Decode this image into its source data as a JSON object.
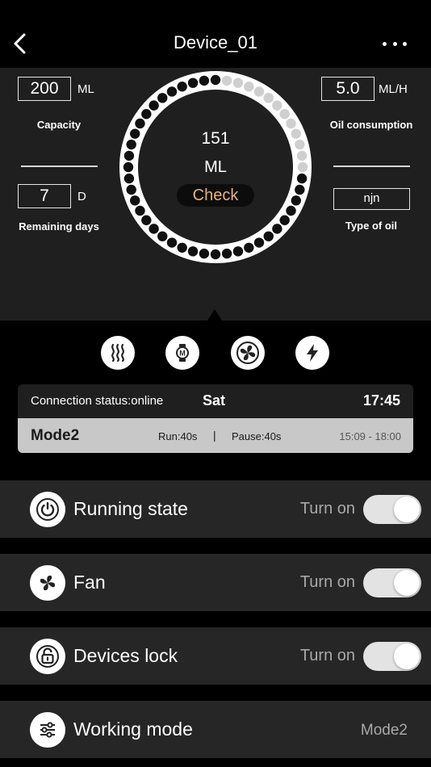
{
  "header": {
    "title": "Device_01"
  },
  "left": {
    "capacity_value": "200",
    "capacity_unit": "ML",
    "capacity_label": "Capacity",
    "days_value": "7",
    "days_unit": "D",
    "days_label": "Remaining days"
  },
  "right": {
    "consumption_value": "5.0",
    "consumption_unit": "ML/H",
    "consumption_label": "Oil consumption",
    "oil_type_value": "njn",
    "oil_type_label": "Type of oil"
  },
  "dial": {
    "reading": "151",
    "unit": "ML",
    "check_label": "Check",
    "level_fraction": 0.75,
    "filled_color": "#111111",
    "empty_color": "#cfcfcf",
    "ring_color": "#ffffff"
  },
  "icons": [
    "heat-icon",
    "device-mode-icon",
    "fan-icon",
    "power-bolt-icon"
  ],
  "status": {
    "connection": "Connection status:online",
    "day": "Sat",
    "time": "17:45",
    "mode": "Mode2",
    "run": "Run:40s",
    "separator": "|",
    "pause": "Pause:40s",
    "range": "15:09 - 18:00"
  },
  "rows": {
    "running": {
      "label": "Running state",
      "state": "Turn on",
      "toggle_on": true
    },
    "fan": {
      "label": "Fan",
      "state": "Turn on",
      "toggle_on": true
    },
    "lock": {
      "label": "Devices lock",
      "state": "Turn on",
      "toggle_on": true
    },
    "mode": {
      "label": "Working mode",
      "value": "Mode2"
    }
  },
  "colors": {
    "accent_check": "#e7b27a",
    "panel": "#1f1f1f",
    "row": "#262626",
    "background": "#000000"
  }
}
